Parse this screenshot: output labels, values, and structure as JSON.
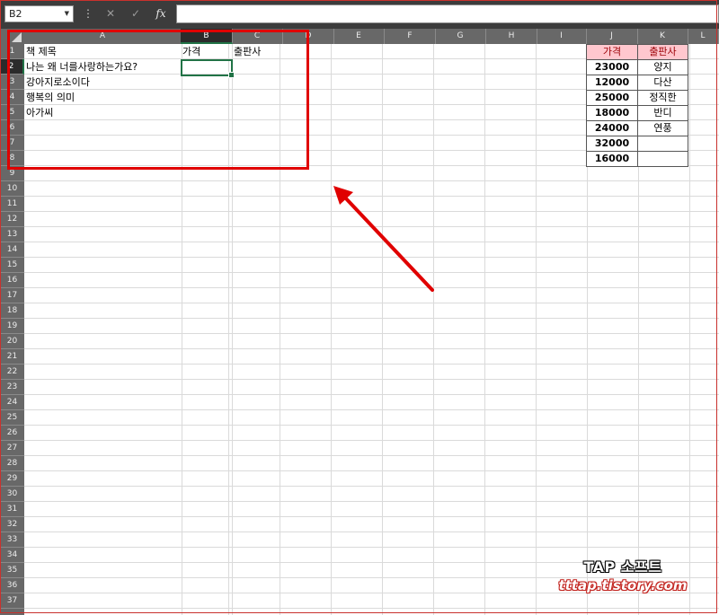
{
  "formula_bar": {
    "name_box": "B2",
    "cancel_glyph": "✕",
    "enter_glyph": "✓",
    "fx_label": "fx",
    "formula": ""
  },
  "columns": [
    "A",
    "B",
    "C",
    "D",
    "E",
    "F",
    "G",
    "H",
    "I",
    "J",
    "K",
    "L"
  ],
  "rows": [
    "1",
    "2",
    "3",
    "4",
    "5",
    "6",
    "7",
    "8",
    "9",
    "10",
    "11",
    "12",
    "13",
    "14",
    "15",
    "16",
    "17",
    "18",
    "19",
    "20",
    "21",
    "22",
    "23",
    "24",
    "25",
    "26",
    "27",
    "28",
    "29",
    "30",
    "31",
    "32",
    "33",
    "34",
    "35",
    "36",
    "37"
  ],
  "active": {
    "cell": "B2",
    "column": "B",
    "row": "2"
  },
  "cells": {
    "A1": "책 제목",
    "B1": "가격",
    "C1": "출판사",
    "A2": "나는 왜 너를사랑하는가요?",
    "A3": "강아지로소이다",
    "A4": "행복의 의미",
    "A5": "아가씨"
  },
  "lookup_table": {
    "header_price": "가격",
    "header_publisher": "출판사",
    "rows": [
      {
        "price": "23000",
        "publisher": "양지"
      },
      {
        "price": "12000",
        "publisher": "다산"
      },
      {
        "price": "25000",
        "publisher": "정직한"
      },
      {
        "price": "18000",
        "publisher": "반디"
      },
      {
        "price": "24000",
        "publisher": "연풍"
      },
      {
        "price": "32000",
        "publisher": ""
      },
      {
        "price": "16000",
        "publisher": ""
      }
    ]
  },
  "watermark": {
    "line1": "TAP 소프트",
    "line2": "tttap.tistory.com"
  },
  "colors": {
    "accent": "#217346",
    "annotation": "#e00000",
    "header_fill": "#ffc7ce",
    "header_text": "#9c0006"
  },
  "annotation": {
    "highlight_box": "red rectangle around A1:C8",
    "arrow": "red arrow pointing to highlight box"
  }
}
